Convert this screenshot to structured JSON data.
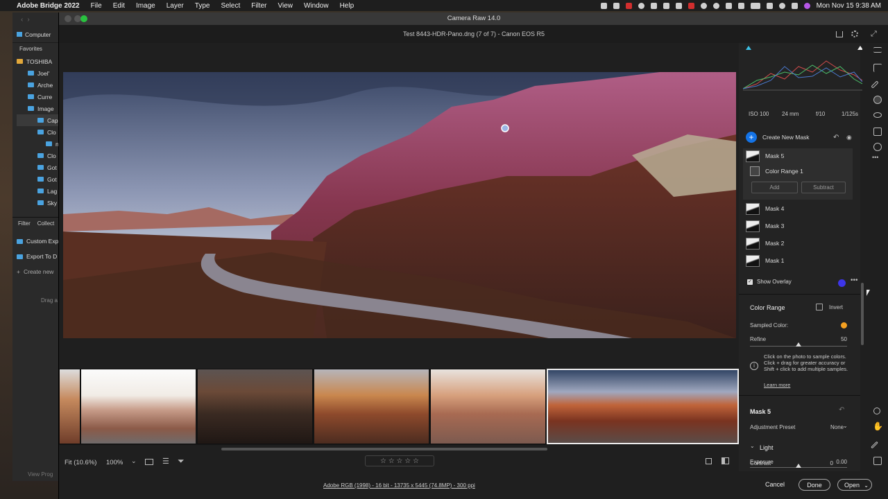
{
  "menubar": {
    "app": "Adobe Bridge 2022",
    "items": [
      "File",
      "Edit",
      "Image",
      "Layer",
      "Type",
      "Select",
      "Filter",
      "View",
      "Window",
      "Help"
    ],
    "clock": "Mon Nov 15  9:38 AM"
  },
  "bridge": {
    "location": "Computer",
    "tab_favorites": "Favorites",
    "tree": [
      "TOSHIBA",
      "Joel'",
      "Arche",
      "Curre",
      "Image",
      "Cap",
      "Clo",
      "n",
      "Clo",
      "Got",
      "Got",
      "Lag",
      "Sky"
    ],
    "tab_filter": "Filter",
    "tab_collect": "Collect",
    "items": [
      "Custom Exp",
      "Export To D"
    ],
    "create_new": "Create new",
    "drag": "Drag a",
    "view_prog": "View Prog"
  },
  "dialog": {
    "title": "Camera Raw 14.0",
    "file_title": "Test 8443-HDR-Pano.dng (7 of 7)  -  Canon EOS R5"
  },
  "toolbar": {
    "fit": "Fit (10.6%)",
    "zoom": "100%",
    "stars": "☆ ☆ ☆ ☆ ☆"
  },
  "footer": {
    "info": "Adobe RGB (1998) - 16 bit - 13735 x 5445 (74.8MP) - 300 ppi",
    "cancel": "Cancel",
    "done": "Done",
    "open": "Open"
  },
  "panel": {
    "exif": {
      "iso": "ISO 100",
      "focal": "24 mm",
      "aperture": "f/10",
      "shutter": "1/125s"
    },
    "create_mask": "Create New Mask",
    "masks": [
      {
        "name": "Mask 5"
      },
      {
        "name": "Color Range 1"
      },
      {
        "name": "Mask 4"
      },
      {
        "name": "Mask 3"
      },
      {
        "name": "Mask 2"
      },
      {
        "name": "Mask 1"
      }
    ],
    "add": "Add",
    "subtract": "Subtract",
    "show_overlay": "Show Overlay",
    "overlay_color": "#3d35e8",
    "color_range": {
      "title": "Color Range",
      "invert": "Invert",
      "sampled_label": "Sampled Color:",
      "sampled_color": "#f4a021",
      "refine_label": "Refine",
      "refine_value": "50",
      "refine_fraction": 0.5,
      "help": "Click on the photo to sample colors. Click + drag for greater accuracy or Shift + click to add multiple samples.",
      "learn_more": "Learn more"
    },
    "mask_section": {
      "title": "Mask 5",
      "preset_label": "Adjustment Preset",
      "preset_value": "None",
      "light_title": "Light",
      "exposure_label": "Exposure",
      "exposure_value": "0.00",
      "exposure_fraction": 0.5,
      "contrast_label": "Contrast",
      "contrast_value": "0",
      "contrast_fraction": 0.5
    }
  }
}
